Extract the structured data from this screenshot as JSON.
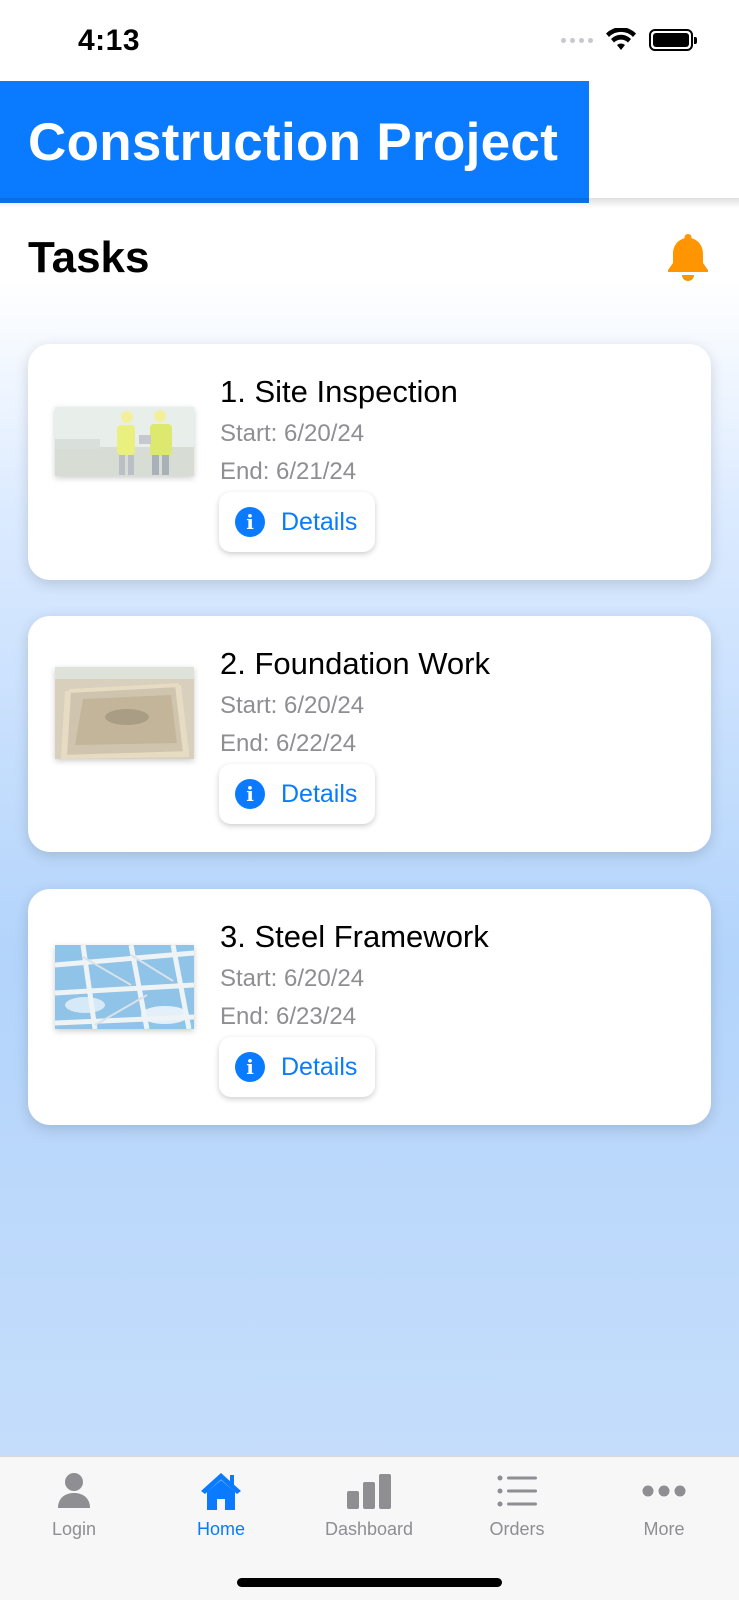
{
  "status_bar": {
    "time": "4:13"
  },
  "header": {
    "title": "Construction Project"
  },
  "main": {
    "heading": "Tasks",
    "tasks": [
      {
        "title": "1. Site Inspection",
        "start": "Start: 6/20/24",
        "end": "End: 6/21/24",
        "details_label": "Details"
      },
      {
        "title": "2. Foundation Work",
        "start": "Start: 6/20/24",
        "end": "End: 6/22/24",
        "details_label": "Details"
      },
      {
        "title": "3. Steel Framework",
        "start": "Start: 6/20/24",
        "end": "End: 6/23/24",
        "details_label": "Details"
      }
    ]
  },
  "tab_bar": {
    "items": [
      {
        "label": "Login",
        "icon": "person-icon"
      },
      {
        "label": "Home",
        "icon": "house-icon",
        "active": true
      },
      {
        "label": "Dashboard",
        "icon": "bar-chart-icon"
      },
      {
        "label": "Orders",
        "icon": "list-icon"
      },
      {
        "label": "More",
        "icon": "more-icon"
      }
    ]
  },
  "colors": {
    "accent": "#0a7bff",
    "bell": "#ff9500",
    "secondary_text": "#8e8e93"
  }
}
